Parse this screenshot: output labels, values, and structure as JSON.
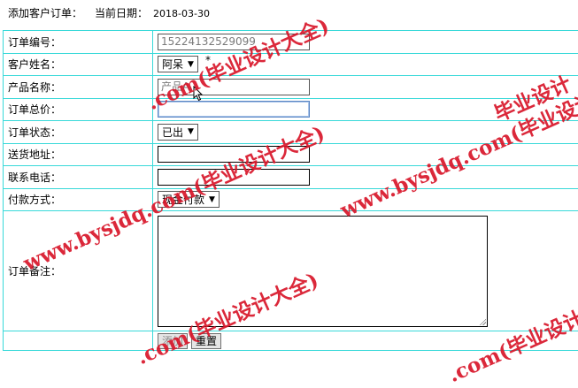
{
  "header": {
    "title": "添加客户订单：",
    "date_label": "当前日期：",
    "date_value": "2018-03-30"
  },
  "form": {
    "order_no": {
      "label": "订单编号：",
      "value": "15224132529099"
    },
    "customer": {
      "label": "客户姓名：",
      "selected": "阿呆",
      "required_mark": "*"
    },
    "product": {
      "label": "产品名称：",
      "value": "产品A"
    },
    "total_price": {
      "label": "订单总价：",
      "value": ""
    },
    "status": {
      "label": "订单状态：",
      "selected": "已出"
    },
    "address": {
      "label": "送货地址：",
      "value": ""
    },
    "phone": {
      "label": "联系电话：",
      "value": ""
    },
    "payment": {
      "label": "付款方式：",
      "selected": "现金付款"
    },
    "note": {
      "label": "订单备注：",
      "value": ""
    }
  },
  "buttons": {
    "add": "添加",
    "reset": "重置"
  },
  "watermarks": [
    ".com(毕业设计大全)",
    "www.bysjdq.com(毕业设计大全)",
    "www.bysjdq.com(毕业设计大全)",
    "毕业设计",
    ".com(毕业设计大全)",
    ".com(毕业设计"
  ],
  "colors": {
    "grid_border": "#38d9d9",
    "watermark": "#d8162a",
    "focus_border": "#5b86c3"
  }
}
